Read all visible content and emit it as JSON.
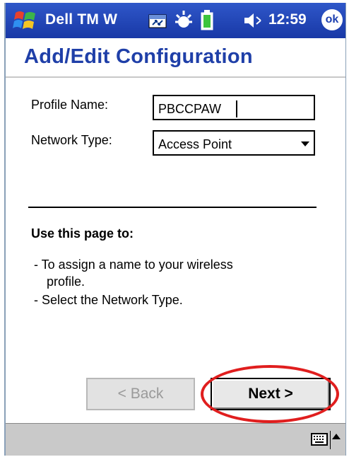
{
  "titlebar": {
    "app_title": "Dell TM W",
    "clock": "12:59",
    "ok_label": "ok"
  },
  "page_title": "Add/Edit Configuration",
  "form": {
    "profile_label": "Profile Name:",
    "profile_value": "PBCCPAW",
    "network_label": "Network Type:",
    "network_selected": "Access Point"
  },
  "help": {
    "heading": "Use this page to:",
    "lines": [
      "-  To assign a name to your wireless",
      "profile.",
      "-  Select the Network Type."
    ]
  },
  "buttons": {
    "back": "< Back",
    "next": "Next >"
  },
  "colors": {
    "titlebar": "#1e40b0",
    "title_text": "#1f3fa8",
    "highlight": "#e01e1e"
  }
}
